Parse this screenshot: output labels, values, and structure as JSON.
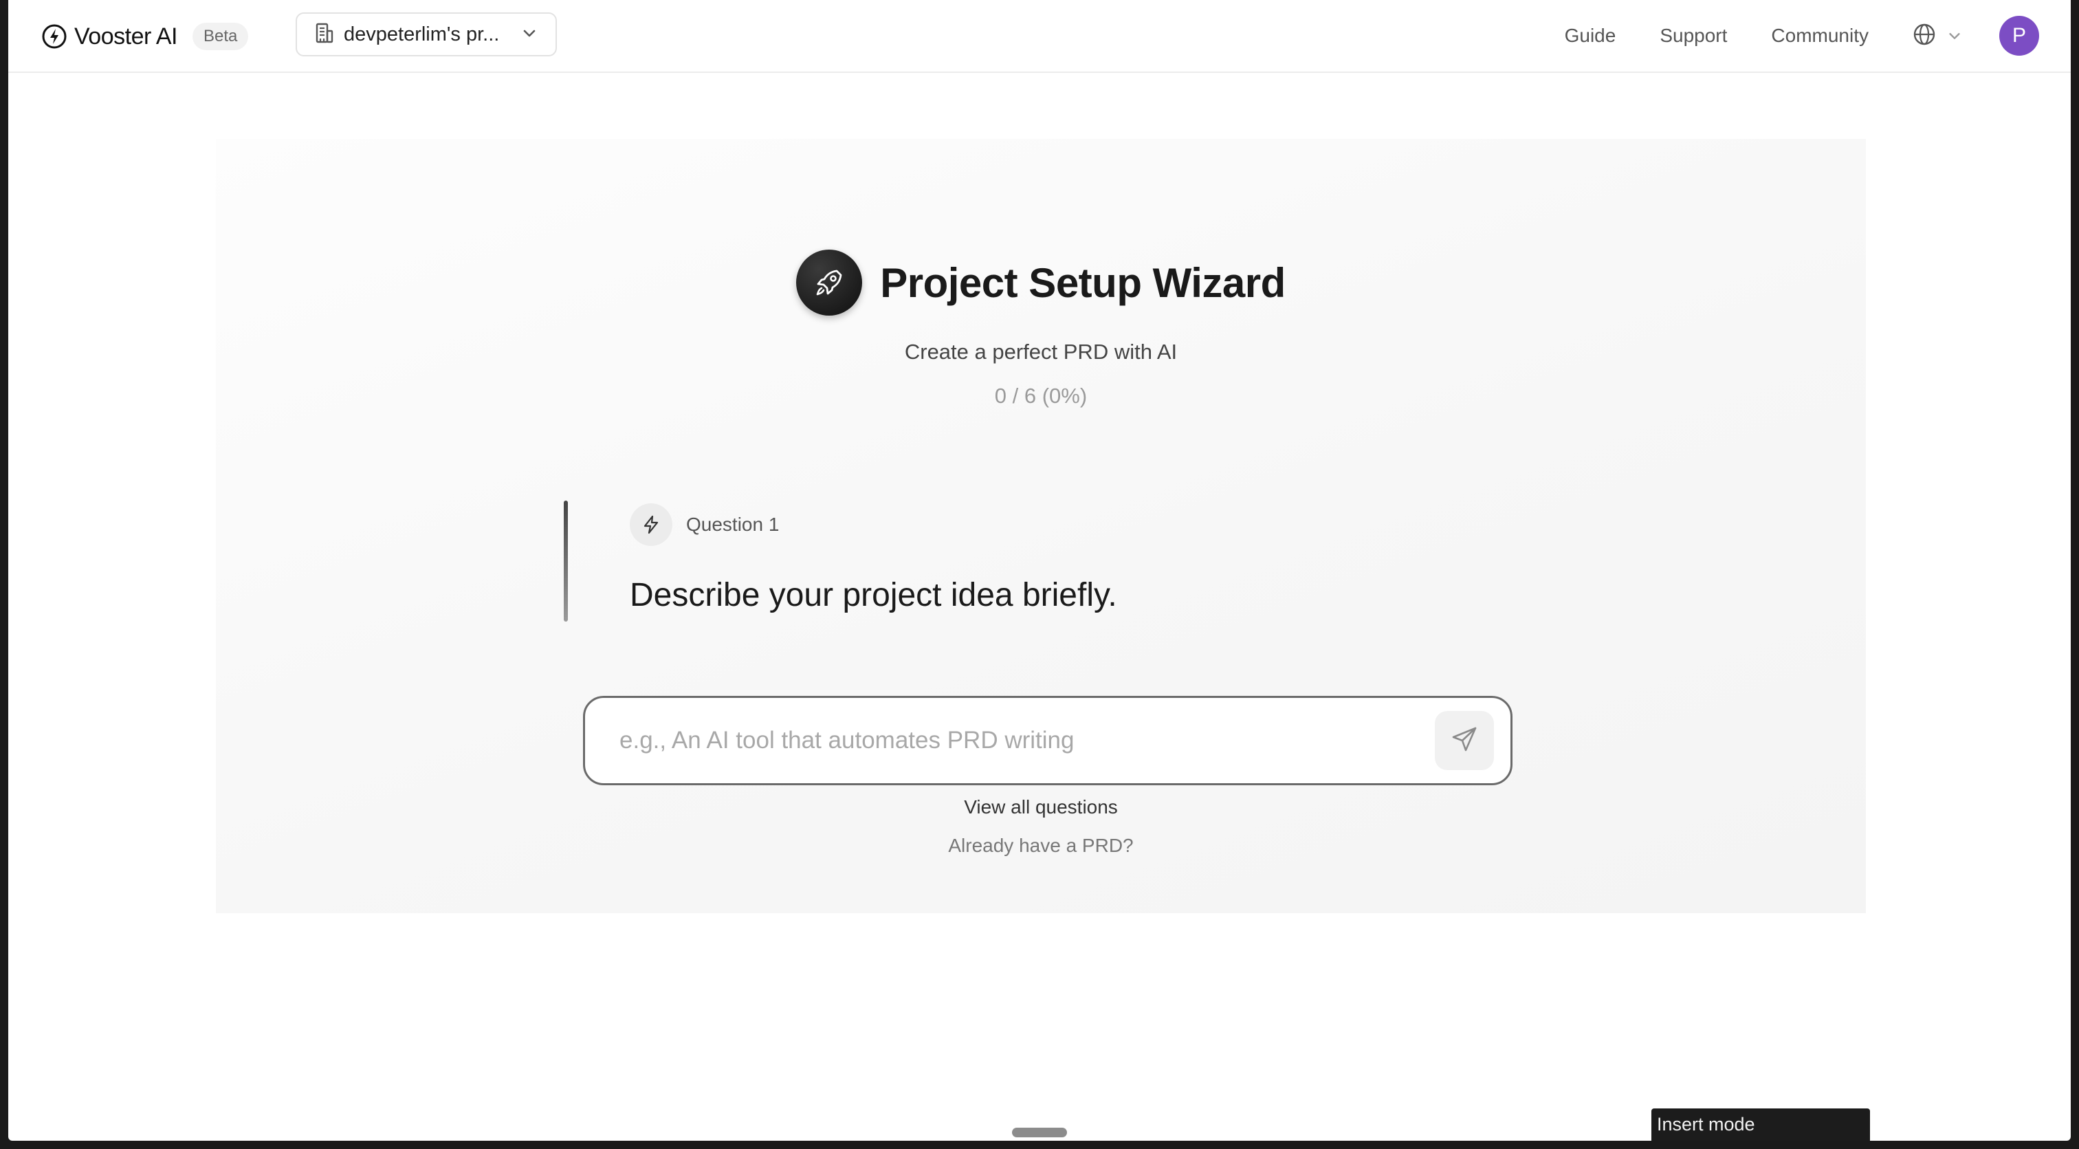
{
  "header": {
    "brand": "Vooster AI",
    "badge": "Beta",
    "workspace": "devpeterlim's pr...",
    "nav": {
      "guide": "Guide",
      "support": "Support",
      "community": "Community"
    },
    "avatar_initial": "P"
  },
  "wizard": {
    "title": "Project Setup Wizard",
    "subtitle": "Create a perfect PRD with AI",
    "progress": "0 / 6 (0%)",
    "progress_fraction": 0,
    "question_label": "Question 1",
    "question_text": "Describe your project idea briefly.",
    "answer_placeholder": "e.g., An AI tool that automates PRD writing",
    "answer_value": "",
    "view_all": "View all questions",
    "have_prd": "Already have a PRD?"
  },
  "status": {
    "mode": "Insert mode"
  },
  "colors": {
    "avatar": "#7c4dc4",
    "accent": "#1a1a1a"
  },
  "icons": [
    "bolt-icon",
    "building-icon",
    "chevron-down-icon",
    "globe-icon",
    "rocket-icon",
    "send-icon"
  ]
}
